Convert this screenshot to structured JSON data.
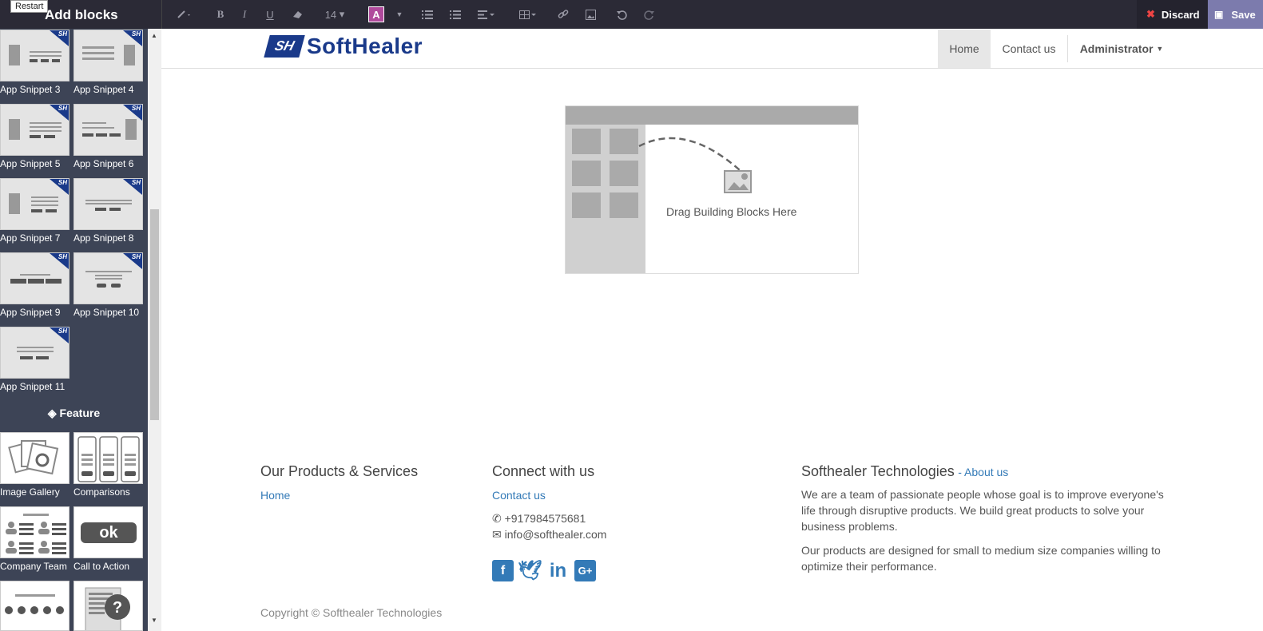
{
  "tooltip": "Restart",
  "sidebar": {
    "title": "Add blocks",
    "snippets": [
      "App Snippet 3",
      "App Snippet 4",
      "App Snippet 5",
      "App Snippet 6",
      "App Snippet 7",
      "App Snippet 8",
      "App Snippet 9",
      "App Snippet 10",
      "App Snippet 11"
    ],
    "snippet_badge": "SH",
    "feature_heading": "Feature",
    "features": [
      "Image Gallery",
      "Comparisons",
      "Company Team",
      "Call to Action"
    ],
    "cta_text": "ok"
  },
  "toolbar": {
    "font_size": "14",
    "discard_label": "Discard",
    "save_label": "Save",
    "accent_color": "#b04a9c"
  },
  "site": {
    "logo_mark": "SH",
    "logo_text": "SoftHealer",
    "nav": [
      "Home",
      "Contact us",
      "Administrator"
    ],
    "dropzone_text": "Drag Building Blocks Here"
  },
  "footer": {
    "col1_title": "Our Products & Services",
    "col1_link": "Home",
    "col2_title": "Connect with us",
    "col2_link": "Contact us",
    "phone": "+917984575681",
    "email": "info@softhealer.com",
    "col3_title": "Softhealer Technologies",
    "col3_about": "- About us",
    "about_p1": "We are a team of passionate people whose goal is to improve everyone's life through disruptive products. We build great products to solve your business problems.",
    "about_p2": "Our products are designed for small to medium size companies willing to optimize their performance.",
    "copyright": "Copyright © Softhealer Technologies"
  }
}
